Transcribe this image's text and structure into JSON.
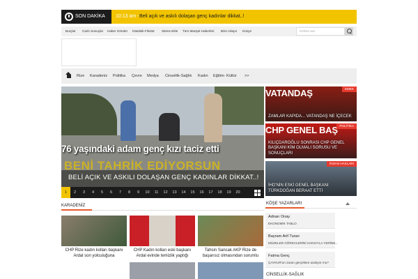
{
  "breaking": {
    "label": "SON DAKİKA",
    "time": "10:13 am -",
    "text": "Beli açık ve askılı dolaşan genç kadınlar dikkat..!"
  },
  "toplinks": [
    "Burçlar",
    "Canlı Sonuçlar",
    "Haber Gönder",
    "İstatistik-Fikstür",
    "Sitene Ekle",
    "Tüm Manşet Haberleri",
    "Bize Ulaşın",
    "Künye"
  ],
  "search": {
    "placeholder": "Kelime ara"
  },
  "nav": [
    "Rize",
    "Karadeniz",
    "Politika",
    "Çevre",
    "Medya",
    "Cinsellik-Sağlık",
    "Kadın",
    "Eğitim- Kültür",
    ">>"
  ],
  "slider": {
    "overlay_text": "76 yaşındaki adam genç kızı taciz etti",
    "overlay_yellow": "BENİ TAHRİK EDİYORSUN",
    "title": "BELİ AÇIK VE ASKILI DOLAŞAN GENÇ KADINLAR DİKKAT..!",
    "pages": [
      "1",
      "2",
      "3",
      "4",
      "5",
      "6",
      "7",
      "8",
      "9",
      "10",
      "11",
      "12",
      "13",
      "14",
      "15",
      "16",
      "17",
      "18",
      "19",
      "20"
    ],
    "active_page": "1"
  },
  "side_cards": [
    {
      "tag": "EMEK",
      "big": "VATANDAŞ",
      "desc": "ZAMLAR KAPIDA... VATANDAŞ NE İÇECEK"
    },
    {
      "tag": "POLİTİKA",
      "big": "CHP GENEL BAŞ",
      "desc": "KILIÇDAROĞLU SONRASI CHP GENEL BAŞKANI KİM OLMALI SORUSU VE SONUÇLARI"
    },
    {
      "tag": "İNSAN HAKLARI",
      "big": "",
      "desc": "İHD'NİN ESKİ GENEL BAŞKANI TÜRKDOĞAN BERAAT ETTİ"
    }
  ],
  "sections": {
    "karadeniz": "KARADENİZ",
    "kose": "KÖŞE YAZARLARI",
    "cinsellik": "CİNSELLİK-SAĞLIK"
  },
  "karadeniz_items": [
    {
      "caption": "CHP Rize kadın kolları başkanı Ardal son yolculuğuna"
    },
    {
      "caption": "CHP Kadın kolları eski başkanı Ardal evinde temizlik yaptığı"
    },
    {
      "caption": "Tahsin Sancak AKP Rize de başarısız olmasından sorumlu"
    }
  ],
  "authors": [
    {
      "name": "Adnan Onay",
      "sub": "EKONOMİK TABLO"
    },
    {
      "name": "Bayram Arif Turan",
      "sub": "MÜZELER GÖREVLERİNİ HAKKIYLA YERİNE..."
    },
    {
      "name": "Fatma Genç",
      "sub": "ÇAYKUR'un zararı gerçekten azalıyor mu?"
    }
  ],
  "colors": {
    "accent": "#f2c400",
    "tag_red": "#e63a2e",
    "section_accent": "#e85a2c"
  }
}
